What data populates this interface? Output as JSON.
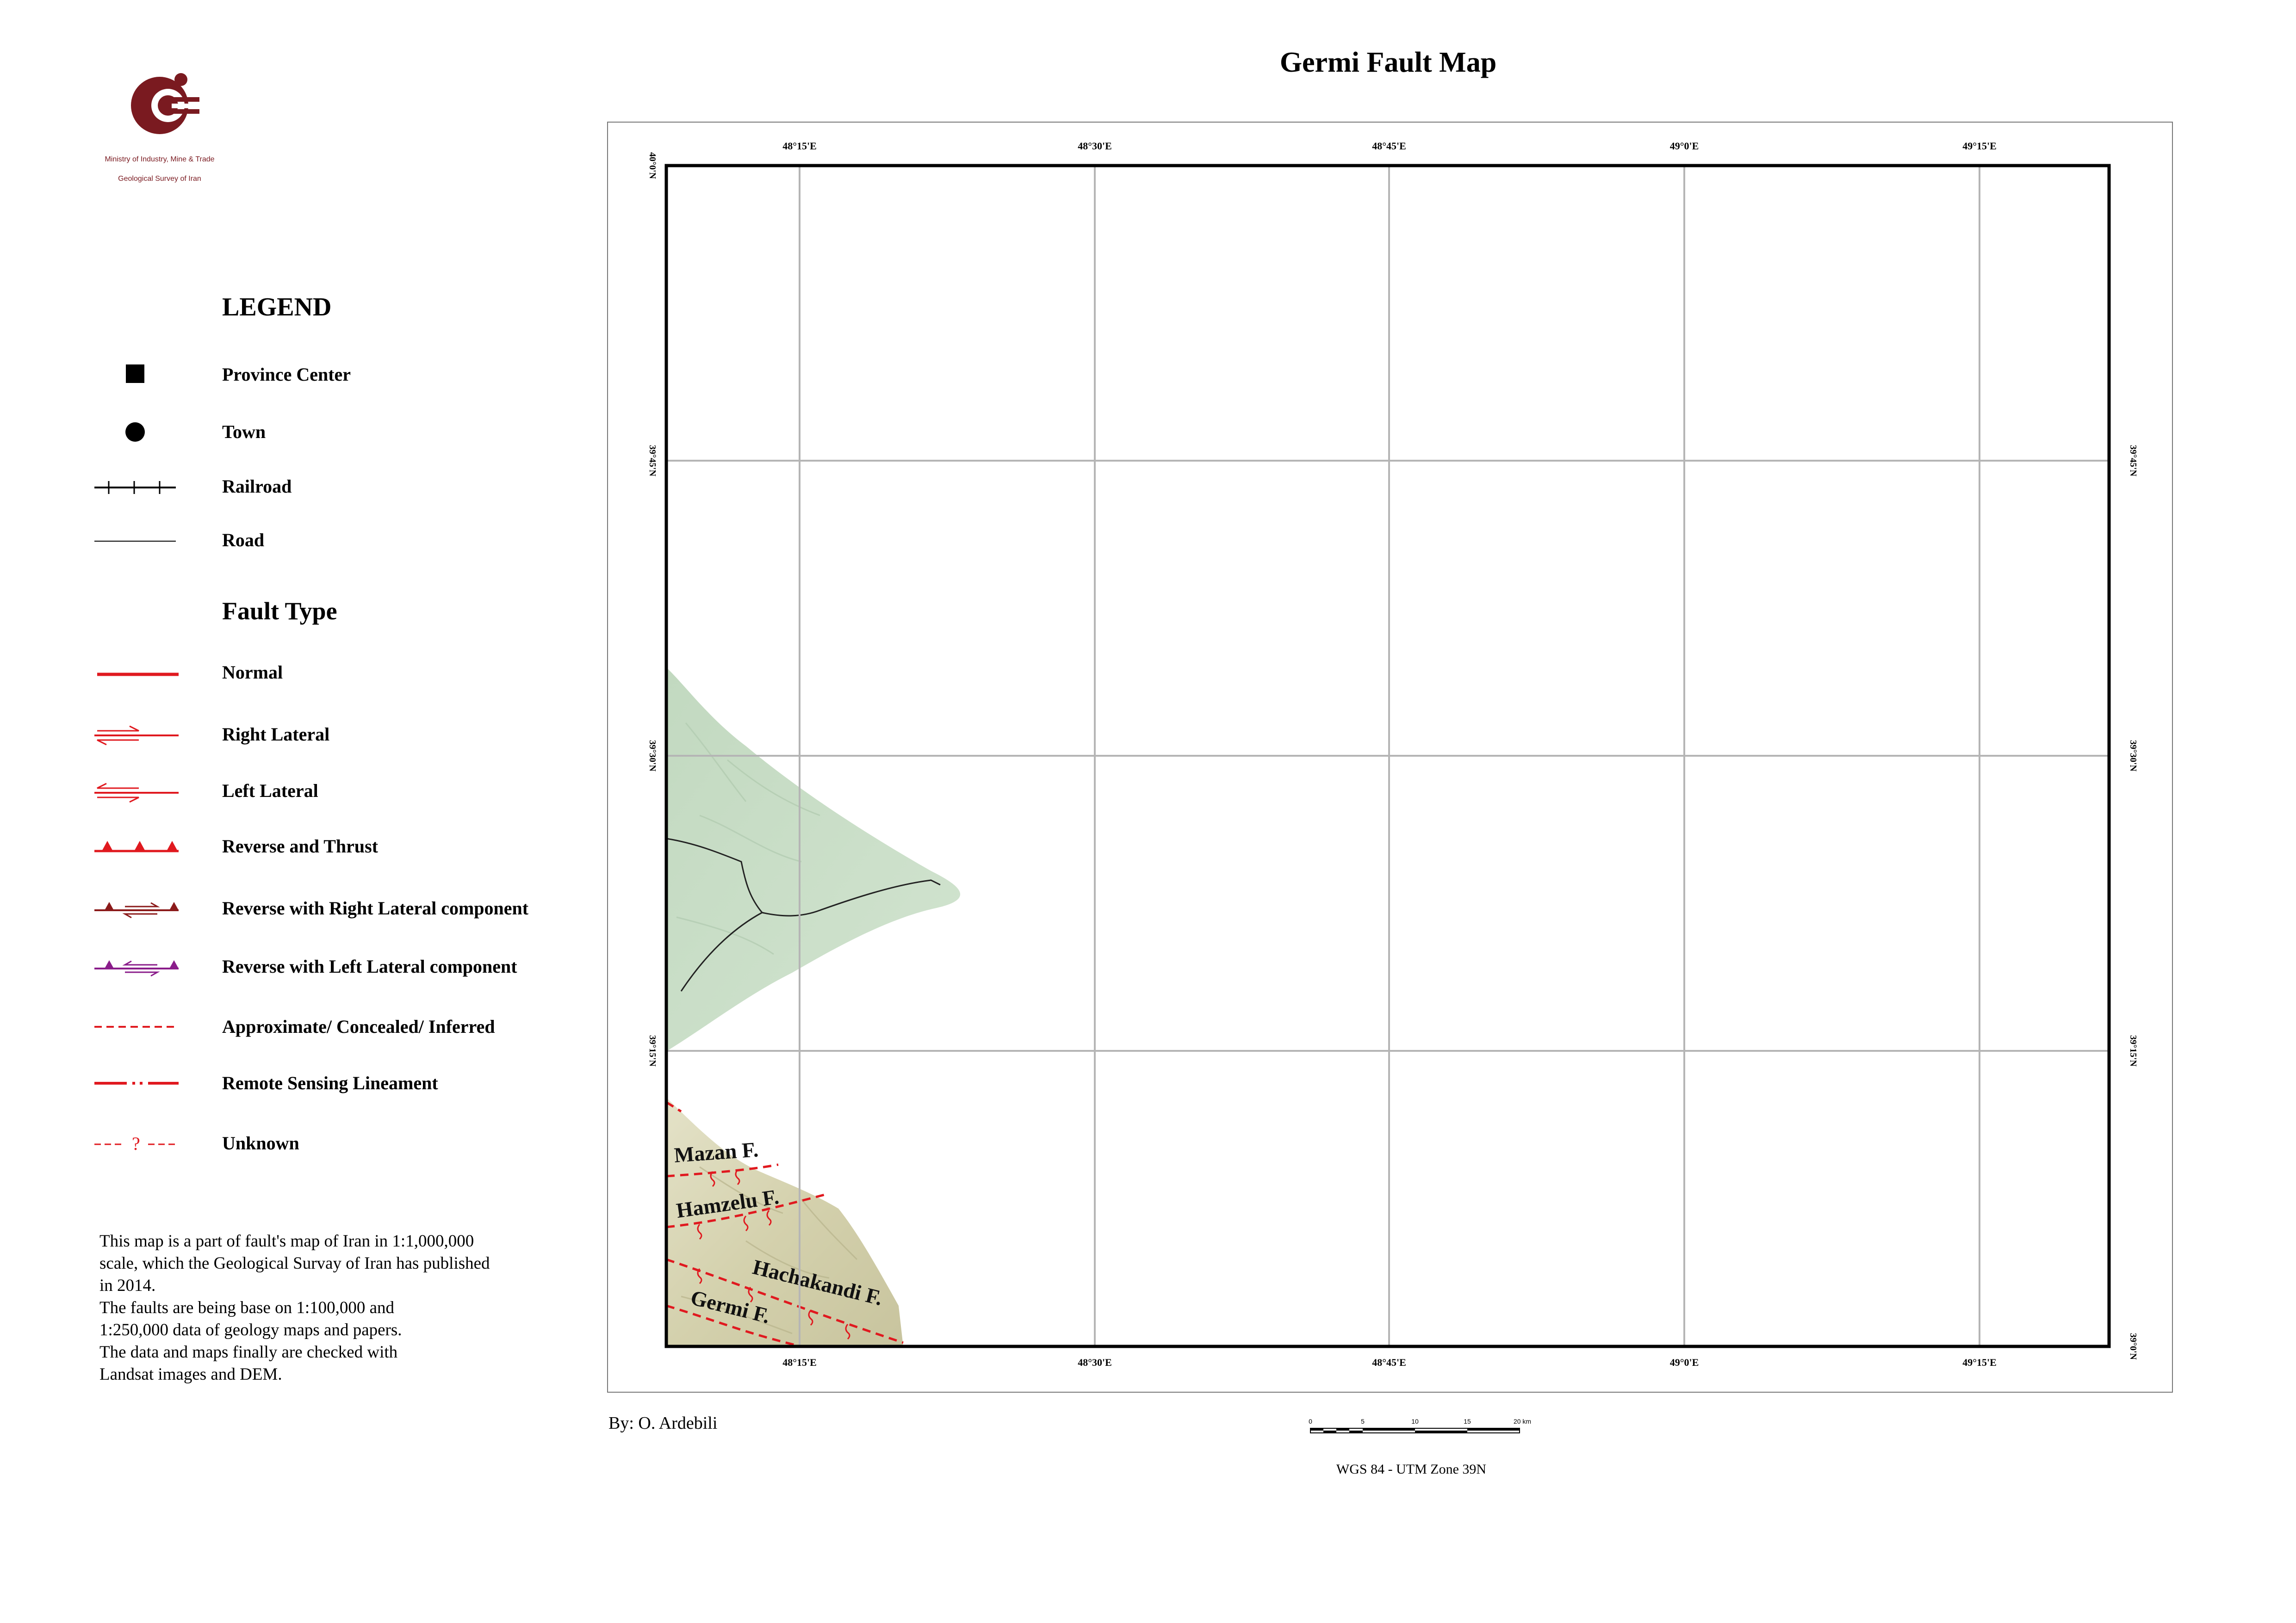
{
  "title": "Germi Fault Map",
  "logo": {
    "org_line1": "Ministry of Industry, Mine & Trade",
    "org_line2": "Geological Survey of Iran",
    "color": "#7a1a20"
  },
  "legend": {
    "title": "LEGEND",
    "items": [
      {
        "label": "Province Center",
        "symbol": "square"
      },
      {
        "label": "Town",
        "symbol": "circle"
      },
      {
        "label": "Railroad",
        "symbol": "railroad"
      },
      {
        "label": "Road",
        "symbol": "road"
      }
    ],
    "fault_type_title": "Fault Type",
    "fault_types": [
      {
        "label": "Normal",
        "symbol": "normal"
      },
      {
        "label": "Right Lateral",
        "symbol": "right-lateral"
      },
      {
        "label": "Left Lateral",
        "symbol": "left-lateral"
      },
      {
        "label": "Reverse and Thrust",
        "symbol": "reverse-thrust"
      },
      {
        "label": "Reverse with Right Lateral component",
        "symbol": "reverse-right"
      },
      {
        "label": "Reverse with Left Lateral component",
        "symbol": "reverse-left"
      },
      {
        "label": "Approximate/ Concealed/ Inferred",
        "symbol": "dashed"
      },
      {
        "label": "Remote Sensing Lineament",
        "symbol": "dash-dot"
      },
      {
        "label": "Unknown",
        "symbol": "unknown"
      }
    ],
    "colors": {
      "fault": "#e0191f",
      "reverse_right": "#8b1a1a",
      "reverse_left": "#8a1c8a"
    }
  },
  "note": {
    "lines": [
      "This map is a part of fault's map of Iran in 1:1,000,000",
      "scale, which the Geological Survay of Iran has published",
      "in 2014.",
      "The faults are being base on 1:100,000 and",
      "1:250,000 data of geology maps and papers.",
      "The data and maps finally are checked with",
      "Landsat images and DEM."
    ]
  },
  "author": "By: O. Ardebili",
  "projection": "WGS 84 - UTM Zone 39N",
  "scale_bar": {
    "ticks": [
      "0",
      "5",
      "10",
      "15",
      "20 km"
    ]
  },
  "map": {
    "lon_labels": [
      "48°15'E",
      "48°30'E",
      "48°45'E",
      "49°0'E",
      "49°15'E"
    ],
    "lat_labels": [
      "40°0'N",
      "39°45'N",
      "39°30'N",
      "39°15'N",
      "39°0'N"
    ],
    "fault_names": [
      "Mazan F.",
      "Hamzelu F.",
      "Hachakandi F.",
      "Germi F."
    ],
    "colors": {
      "grid": "#b5b5b5",
      "terrain_green": "#c7dcc4",
      "terrain_tan": "#ddd9b8",
      "fault": "#e0191f"
    }
  }
}
